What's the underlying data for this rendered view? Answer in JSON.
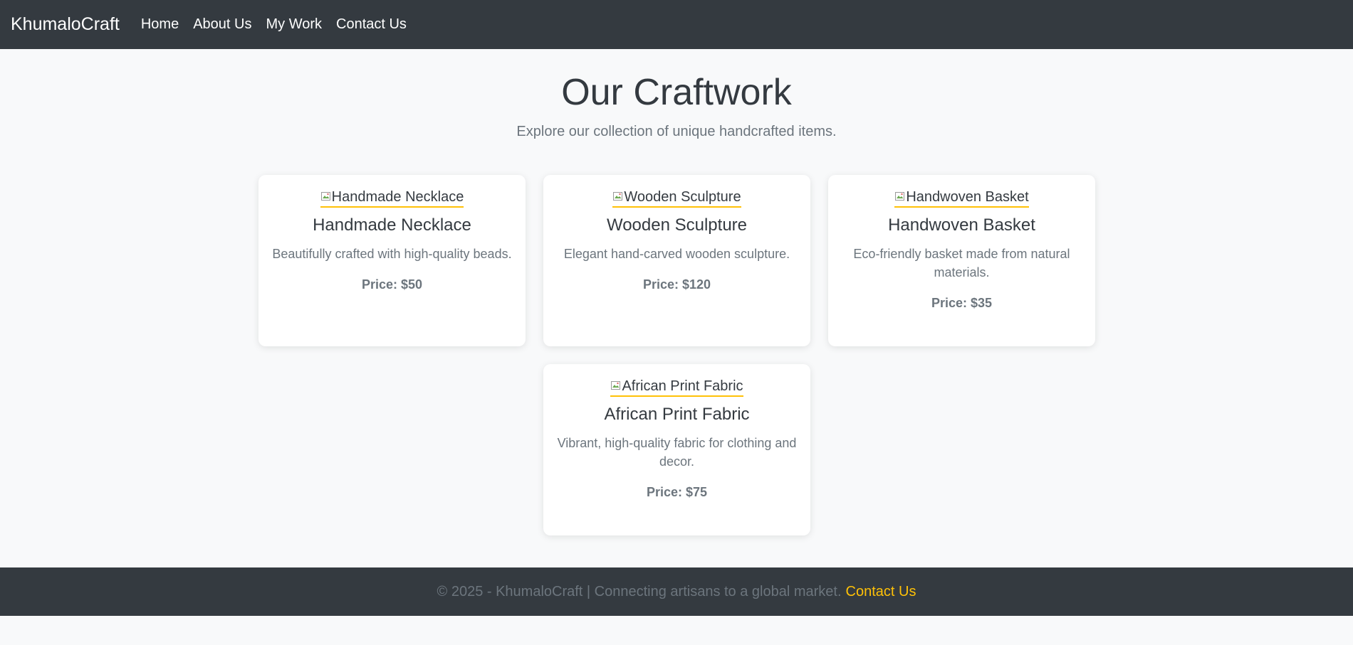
{
  "navbar": {
    "brand": "KhumaloCraft",
    "links": [
      "Home",
      "About Us",
      "My Work",
      "Contact Us"
    ]
  },
  "hero": {
    "title": "Our Craftwork",
    "subtitle": "Explore our collection of unique handcrafted items."
  },
  "products": [
    {
      "image_alt": "Handmade Necklace",
      "name": "Handmade Necklace",
      "description": "Beautifully crafted with high-quality beads.",
      "price": "Price: $50"
    },
    {
      "image_alt": "Wooden Sculpture",
      "name": "Wooden Sculpture",
      "description": "Elegant hand-carved wooden sculpture.",
      "price": "Price: $120"
    },
    {
      "image_alt": "Handwoven Basket",
      "name": "Handwoven Basket",
      "description": "Eco-friendly basket made from natural materials.",
      "price": "Price: $35"
    },
    {
      "image_alt": "African Print Fabric",
      "name": "African Print Fabric",
      "description": "Vibrant, high-quality fabric for clothing and decor.",
      "price": "Price: $75"
    }
  ],
  "footer": {
    "text": "© 2025 - KhumaloCraft | Connecting artisans to a global market.",
    "link": "Contact Us"
  },
  "colors": {
    "nav_bg": "#343a40",
    "accent": "#ffc107",
    "page_bg": "#f8f9fa",
    "muted_text": "#6c757d"
  }
}
